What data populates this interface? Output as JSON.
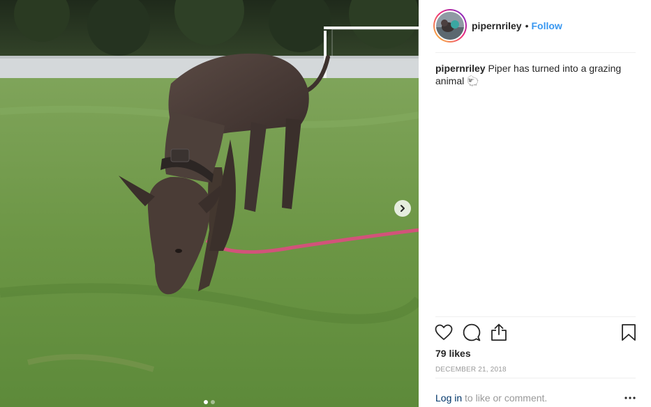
{
  "post": {
    "username": "pipernriley",
    "separator": "•",
    "follow_label": "Follow",
    "caption_text": " Piper has turned into a grazing animal 🐑",
    "likes": "79 likes",
    "date": "DECEMBER 21, 2018",
    "login_link": "Log in",
    "login_suffix": " to like or comment."
  },
  "icons": {
    "like": "heart-icon",
    "comment": "comment-icon",
    "share": "share-icon",
    "save": "bookmark-icon",
    "more": "more-icon",
    "next": "chevron-right-icon"
  },
  "colors": {
    "link_blue": "#3897f0",
    "text": "#262626",
    "muted": "#999999",
    "login": "#003569"
  }
}
